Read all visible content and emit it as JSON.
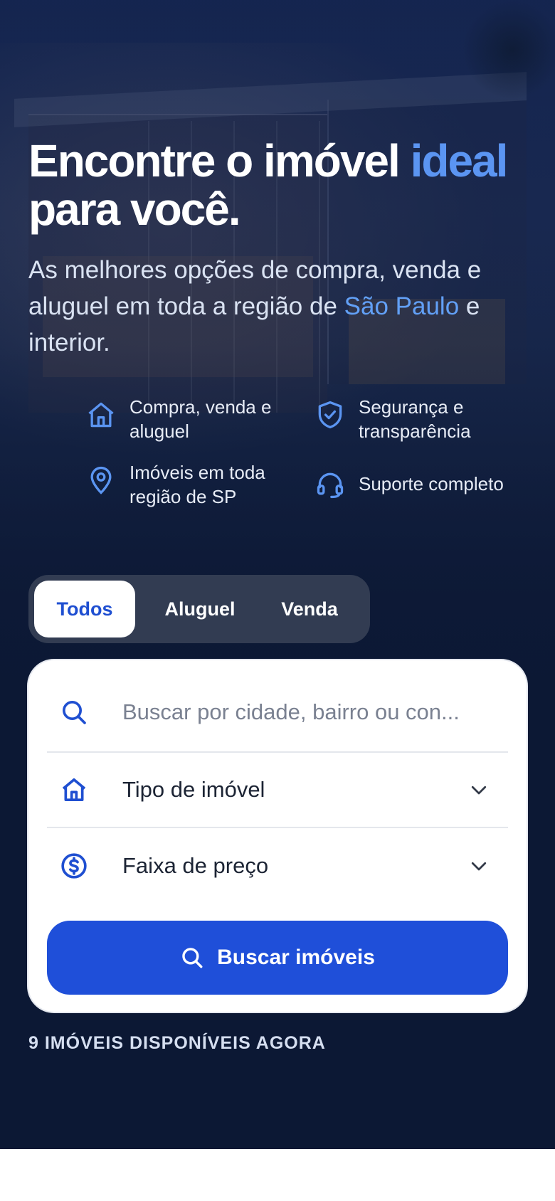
{
  "hero": {
    "title_main": "Encontre o imóvel ",
    "title_accent": "ideal",
    "title_line2": "para você.",
    "subtitle_part1": "As melhores opções de compra, venda e aluguel em toda a região de ",
    "subtitle_accent": "São Paulo",
    "subtitle_part2": " e interior."
  },
  "features": [
    {
      "icon": "house-icon",
      "line1": "Compra, venda e",
      "line2": "aluguel"
    },
    {
      "icon": "shield-check-icon",
      "line1": "Segurança e",
      "line2": "transparência"
    },
    {
      "icon": "map-pin-icon",
      "line1": "Imóveis em toda",
      "line2": "região de SP"
    },
    {
      "icon": "headset-icon",
      "line1": "Suporte completo",
      "line2": ""
    }
  ],
  "tabs": {
    "items": [
      "Todos",
      "Aluguel",
      "Venda"
    ],
    "active": "Todos"
  },
  "search": {
    "placeholder": "Buscar por cidade, bairro ou con...",
    "type_label": "Tipo de imóvel",
    "price_label": "Faixa de preço",
    "button_label": "Buscar imóveis"
  },
  "available_text": "9 IMÓVEIS DISPONÍVEIS AGORA",
  "colors": {
    "accent": "#5b95f2",
    "primary_button": "#1f4fd9",
    "hero_bg": "#0c1834"
  }
}
